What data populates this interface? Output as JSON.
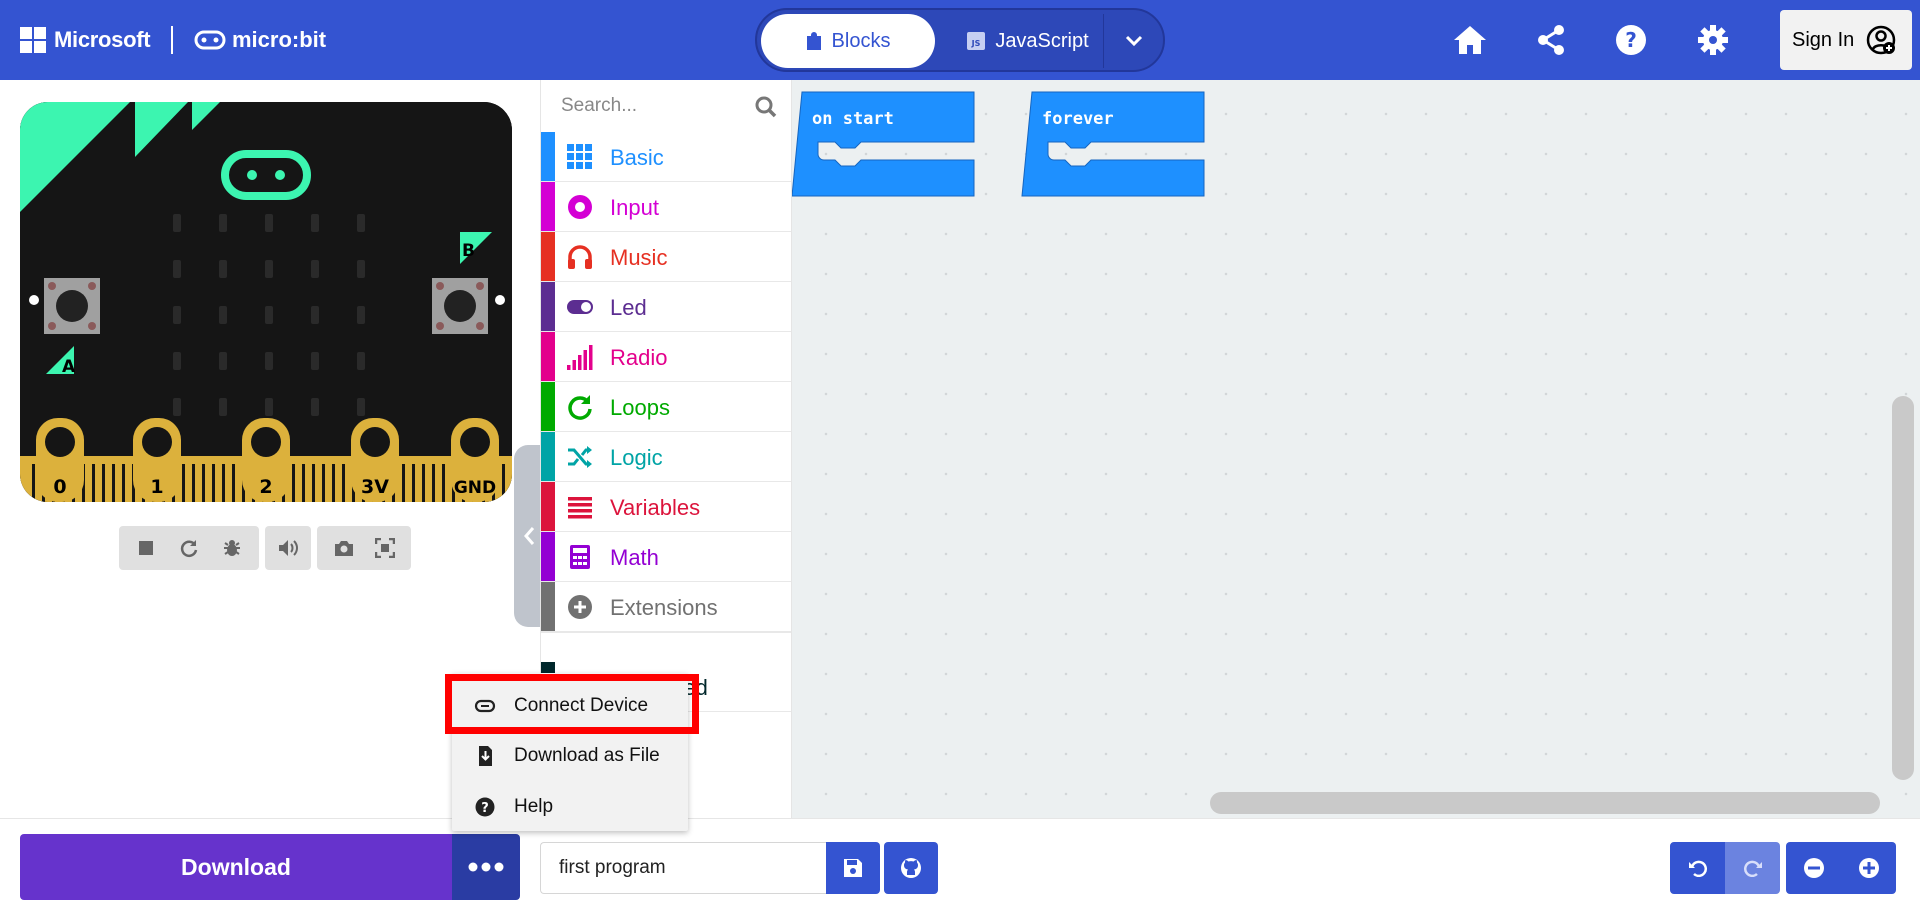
{
  "header": {
    "microsoft_label": "Microsoft",
    "microbit_label": "micro:bit",
    "tabs": {
      "blocks_label": "Blocks",
      "javascript_label": "JavaScript"
    },
    "sign_in_label": "Sign In"
  },
  "simulator": {
    "pins": [
      "0",
      "1",
      "2",
      "3V",
      "GND"
    ],
    "button_a_label": "A",
    "button_b_label": "B"
  },
  "toolbox": {
    "search_placeholder": "Search...",
    "categories": [
      {
        "label": "Basic",
        "color": "#1e90ff",
        "icon": "grid-icon"
      },
      {
        "label": "Input",
        "color": "#d400d4",
        "icon": "radio-button-icon"
      },
      {
        "label": "Music",
        "color": "#e63022",
        "icon": "headphones-icon"
      },
      {
        "label": "Led",
        "color": "#5c2d91",
        "icon": "toggle-icon"
      },
      {
        "label": "Radio",
        "color": "#e3008c",
        "icon": "signal-bars-icon"
      },
      {
        "label": "Loops",
        "color": "#00aa00",
        "icon": "loop-arrow-icon"
      },
      {
        "label": "Logic",
        "color": "#00a4a6",
        "icon": "shuffle-icon"
      },
      {
        "label": "Variables",
        "color": "#dc143c",
        "icon": "list-lines-icon"
      },
      {
        "label": "Math",
        "color": "#9400d3",
        "icon": "calculator-icon"
      },
      {
        "label": "Extensions",
        "color": "#717171",
        "icon": "plus-circle-icon"
      },
      {
        "label": "Advanced",
        "color": "#00272b",
        "icon": "chevron-down-icon"
      }
    ]
  },
  "workspace": {
    "blocks": [
      {
        "label": "on start"
      },
      {
        "label": "forever"
      }
    ],
    "block_color": "#1e90ff"
  },
  "footer": {
    "download_label": "Download",
    "project_name": "first program"
  },
  "download_menu": {
    "items": [
      {
        "label": "Connect Device",
        "icon": "usb-link-icon"
      },
      {
        "label": "Download as File",
        "icon": "file-download-icon"
      },
      {
        "label": "Help",
        "icon": "question-circle-icon"
      }
    ]
  },
  "colors": {
    "header_bg": "#3454d1",
    "download_bg": "#6633cc",
    "highlight": "#ff0000",
    "board_accent": "#3cf5b0",
    "pin_gold": "#dcb13c"
  }
}
